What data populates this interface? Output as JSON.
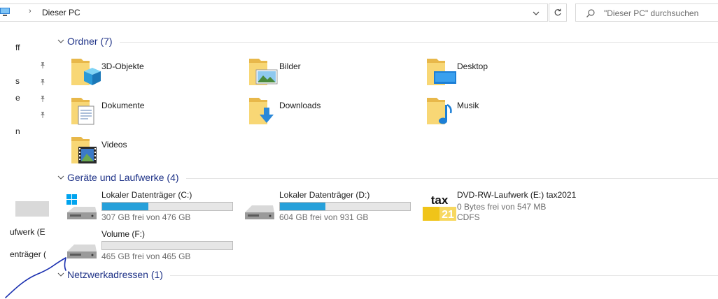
{
  "address": {
    "crumb_separator": "›",
    "location": "Dieser PC",
    "search_placeholder": "\"Dieser PC\" durchsuchen"
  },
  "nav": {
    "items": [
      {
        "label": "ff"
      },
      {
        "label": ""
      },
      {
        "label": "s"
      },
      {
        "label": "e"
      },
      {
        "label": ""
      },
      {
        "label": "n"
      },
      {
        "label": "ufwerk (E"
      },
      {
        "label": "enträger ("
      }
    ]
  },
  "groups": {
    "folders": {
      "title": "Ordner (7)"
    },
    "drives": {
      "title": "Geräte und Laufwerke (4)"
    },
    "network": {
      "title": "Netzwerkadressen (1)"
    }
  },
  "folders": [
    {
      "label": "3D-Objekte",
      "icon": "3d-objects-folder-icon"
    },
    {
      "label": "Bilder",
      "icon": "pictures-folder-icon"
    },
    {
      "label": "Desktop",
      "icon": "desktop-folder-icon"
    },
    {
      "label": "Dokumente",
      "icon": "documents-folder-icon"
    },
    {
      "label": "Downloads",
      "icon": "downloads-folder-icon"
    },
    {
      "label": "Musik",
      "icon": "music-folder-icon"
    },
    {
      "label": "Videos",
      "icon": "videos-folder-icon"
    }
  ],
  "drives": [
    {
      "name": "Lokaler Datenträger (C:)",
      "free_text": "307 GB frei von 476 GB",
      "used_fraction": 0.355,
      "icon": "windows-drive-icon"
    },
    {
      "name": "Lokaler Datenträger (D:)",
      "free_text": "604 GB frei von 931 GB",
      "used_fraction": 0.351,
      "icon": "hard-drive-icon"
    },
    {
      "name": "DVD-RW-Laufwerk (E:) tax2021",
      "free_text": "0 Bytes frei von 547 MB",
      "filesystem": "CDFS",
      "icon": "tax-disc-icon",
      "icon_text_top": "tax",
      "icon_text_bottom": "21"
    },
    {
      "name": "Volume (F:)",
      "free_text": "465 GB frei von 465 GB",
      "used_fraction": 0.0,
      "icon": "hard-drive-icon"
    }
  ],
  "colors": {
    "accent_header": "#1e3287",
    "bar_fill": "#26a0da",
    "folder_yellow": "#f8d775",
    "annotation_ink": "#1a2fb0"
  }
}
